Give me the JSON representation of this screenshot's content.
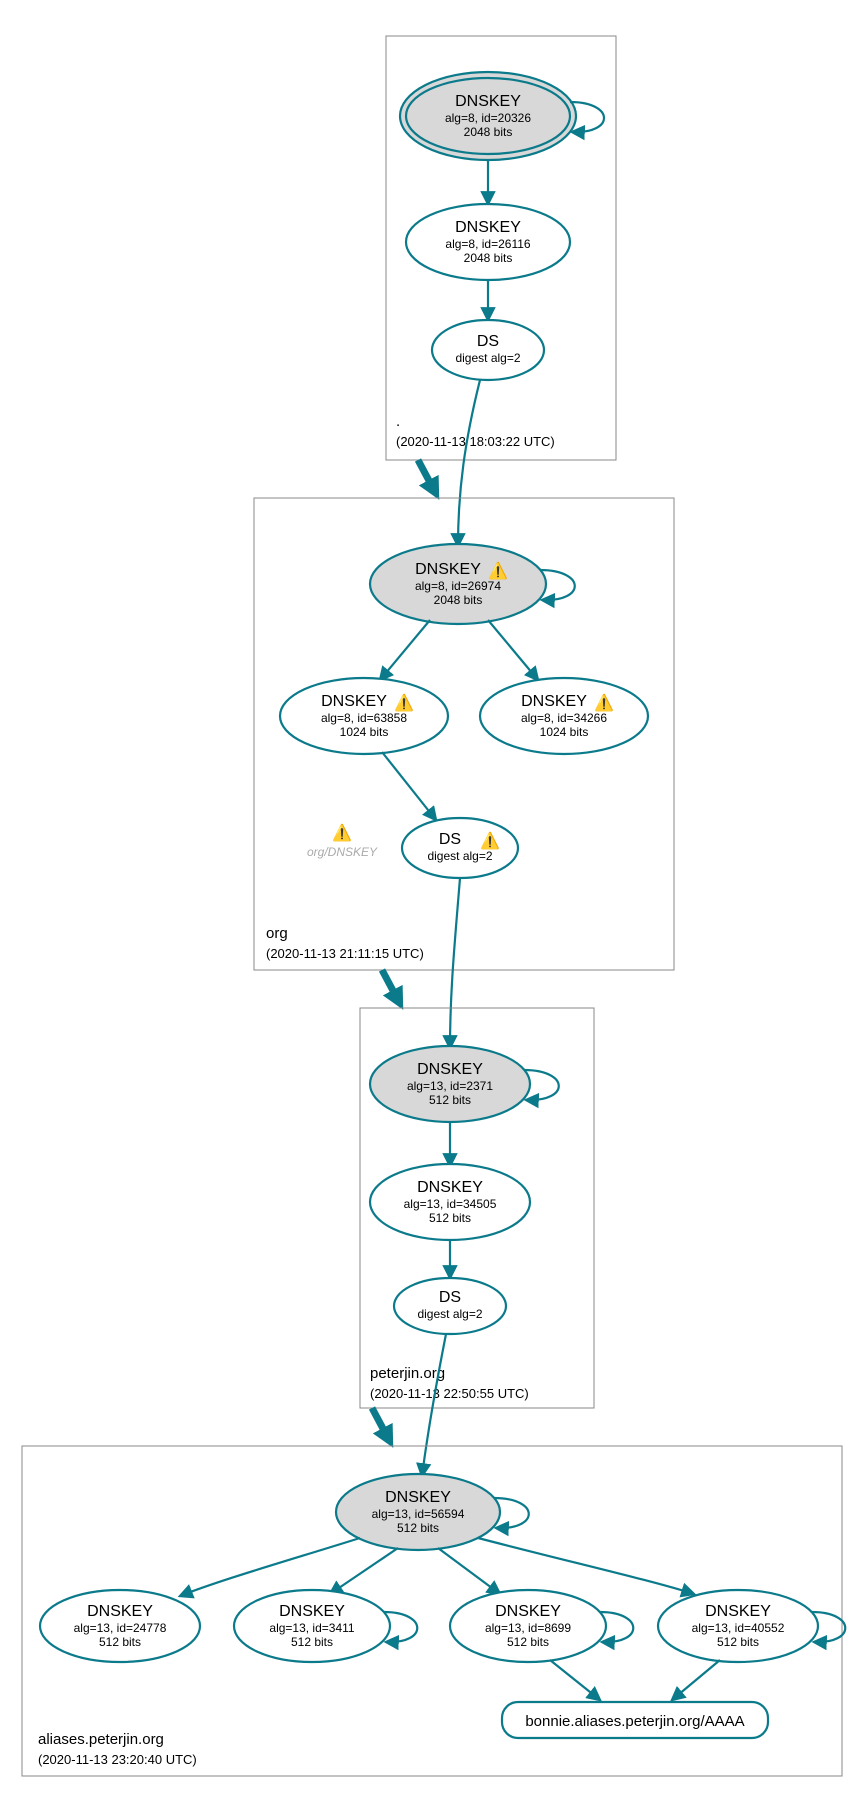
{
  "zones": {
    "root": {
      "label": ".",
      "time": "(2020-11-13 18:03:22 UTC)"
    },
    "org": {
      "label": "org",
      "time": "(2020-11-13 21:11:15 UTC)"
    },
    "peterjin": {
      "label": "peterjin.org",
      "time": "(2020-11-13 22:50:55 UTC)"
    },
    "aliases": {
      "label": "aliases.peterjin.org",
      "time": "(2020-11-13 23:20:40 UTC)"
    }
  },
  "nodes": {
    "root_ksk": {
      "title": "DNSKEY",
      "line1": "alg=8, id=20326",
      "line2": "2048 bits"
    },
    "root_zsk": {
      "title": "DNSKEY",
      "line1": "alg=8, id=26116",
      "line2": "2048 bits"
    },
    "root_ds": {
      "title": "DS",
      "line1": "digest alg=2"
    },
    "org_ksk": {
      "title": "DNSKEY",
      "line1": "alg=8, id=26974",
      "line2": "2048 bits",
      "warn": true
    },
    "org_zsk1": {
      "title": "DNSKEY",
      "line1": "alg=8, id=63858",
      "line2": "1024 bits",
      "warn": true
    },
    "org_zsk2": {
      "title": "DNSKEY",
      "line1": "alg=8, id=34266",
      "line2": "1024 bits",
      "warn": true
    },
    "org_ds": {
      "title": "DS",
      "line1": "digest alg=2",
      "warn": true
    },
    "org_faded": {
      "label": "org/DNSKEY"
    },
    "pj_ksk": {
      "title": "DNSKEY",
      "line1": "alg=13, id=2371",
      "line2": "512 bits"
    },
    "pj_zsk": {
      "title": "DNSKEY",
      "line1": "alg=13, id=34505",
      "line2": "512 bits"
    },
    "pj_ds": {
      "title": "DS",
      "line1": "digest alg=2"
    },
    "al_ksk": {
      "title": "DNSKEY",
      "line1": "alg=13, id=56594",
      "line2": "512 bits"
    },
    "al_k1": {
      "title": "DNSKEY",
      "line1": "alg=13, id=24778",
      "line2": "512 bits"
    },
    "al_k2": {
      "title": "DNSKEY",
      "line1": "alg=13, id=3411",
      "line2": "512 bits"
    },
    "al_k3": {
      "title": "DNSKEY",
      "line1": "alg=13, id=8699",
      "line2": "512 bits"
    },
    "al_k4": {
      "title": "DNSKEY",
      "line1": "alg=13, id=40552",
      "line2": "512 bits"
    },
    "al_rr": {
      "label": "bonnie.aliases.peterjin.org/AAAA"
    }
  }
}
